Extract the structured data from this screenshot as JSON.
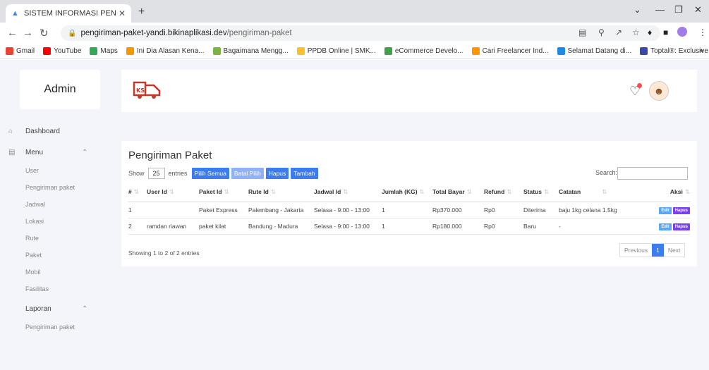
{
  "browser": {
    "tab_title": "SISTEM INFORMASI PENGIRIMAN",
    "url_host": "pengiriman-paket-yandi.bikinaplikasi.dev",
    "url_path": "/pengiriman-paket",
    "bookmarks": [
      {
        "label": "Gmail",
        "color": "#ea4335"
      },
      {
        "label": "YouTube",
        "color": "#ff0000"
      },
      {
        "label": "Maps",
        "color": "#34a853"
      },
      {
        "label": "Ini Dia Alasan Kena...",
        "color": "#f29900"
      },
      {
        "label": "Bagaimana Mengg...",
        "color": "#7cb342"
      },
      {
        "label": "PPDB Online | SMK...",
        "color": "#fbc02d"
      },
      {
        "label": "eCommerce Develo...",
        "color": "#43a047"
      },
      {
        "label": "Cari Freelancer Ind...",
        "color": "#ff9800"
      },
      {
        "label": "Selamat Datang di...",
        "color": "#1e88e5"
      },
      {
        "label": "Toptal®: Exclusive...",
        "color": "#3949ab"
      }
    ]
  },
  "brand": "Admin",
  "sidebar": {
    "dashboard": "Dashboard",
    "menu": "Menu",
    "items": [
      "User",
      "Pengiriman paket",
      "Jadwal",
      "Lokasi",
      "Rute",
      "Paket",
      "Mobil",
      "Fasilitas"
    ],
    "laporan": "Laporan",
    "laporan_items": [
      "Pengiriman paket"
    ]
  },
  "main": {
    "title": "Pengiriman Paket",
    "show_label": "Show",
    "entries_value": "25",
    "entries_label": "entries",
    "buttons": {
      "pilih_semua": "Pilih Semua",
      "batal_pilih": "Batal Pilih",
      "hapus": "Hapus",
      "tambah": "Tambah"
    },
    "search_label": "Search:",
    "columns": [
      "#",
      "User Id",
      "Paket Id",
      "Rute Id",
      "Jadwal Id",
      "Jumlah (KG)",
      "Total Bayar",
      "Refund",
      "Status",
      "Catatan",
      "Aksi"
    ],
    "rows": [
      {
        "no": "1",
        "user": "",
        "paket": "Paket Express",
        "rute": "Palembang - Jakarta",
        "jadwal": "Selasa - 9:00 - 13:00",
        "jumlah": "1",
        "total": "Rp370.000",
        "refund": "Rp0",
        "status": "Diterima",
        "catatan": "baju 1kg celana 1.5kg"
      },
      {
        "no": "2",
        "user": "ramdan riawan",
        "paket": "paket kilat",
        "rute": "Bandung - Madura",
        "jadwal": "Selasa - 9:00 - 13:00",
        "jumlah": "1",
        "total": "Rp180.000",
        "refund": "Rp0",
        "status": "Baru",
        "catatan": "-"
      }
    ],
    "action_edit": "Edit",
    "action_delete": "Hapus",
    "info": "Showing 1 to 2 of 2 entries",
    "pager": {
      "previous": "Previous",
      "current": "1",
      "next": "Next"
    }
  }
}
